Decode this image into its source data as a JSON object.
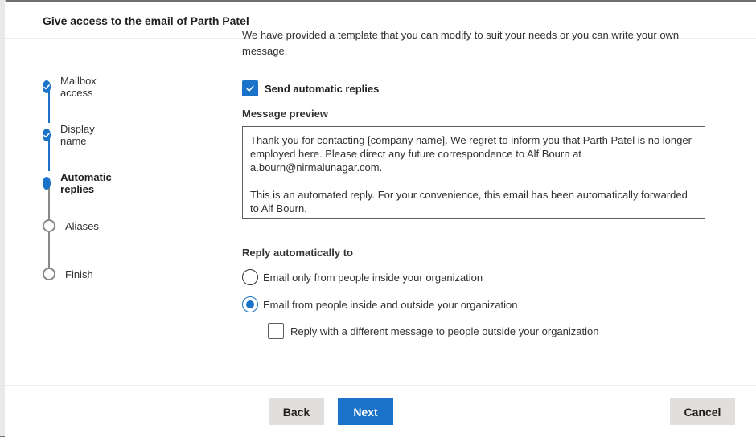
{
  "dialog": {
    "title": "Give access to the email of Parth Patel"
  },
  "steps": [
    {
      "label": "Mailbox access",
      "state": "done"
    },
    {
      "label": "Display name",
      "state": "done"
    },
    {
      "label": "Automatic replies",
      "state": "current"
    },
    {
      "label": "Aliases",
      "state": "todo"
    },
    {
      "label": "Finish",
      "state": "todo"
    }
  ],
  "content": {
    "intro_text": "We have provided a template that you can modify to suit your needs or you can write your own message.",
    "send_auto_replies": {
      "label": "Send automatic replies",
      "checked": true
    },
    "message_preview_label": "Message preview",
    "message_preview": "Thank you for contacting [company name]. We regret to inform you that Parth Patel is no longer employed here. Please direct any future correspondence to Alf Bourn at a.bourn@nirmalunagar.com.\n\n This is an automated reply. For your convenience, this email has been automatically forwarded to Alf Bourn.",
    "reply_to_label": "Reply automatically to",
    "reply_options": [
      {
        "label": "Email only from people inside your organization",
        "selected": false
      },
      {
        "label": "Email from people inside and outside your organization",
        "selected": true
      }
    ],
    "different_message": {
      "label": "Reply with a different message to people outside your organization",
      "checked": false
    }
  },
  "footer": {
    "back_label": "Back",
    "next_label": "Next",
    "cancel_label": "Cancel"
  },
  "colors": {
    "accent": "#1a73c8",
    "step_todo": "#8a8886"
  }
}
